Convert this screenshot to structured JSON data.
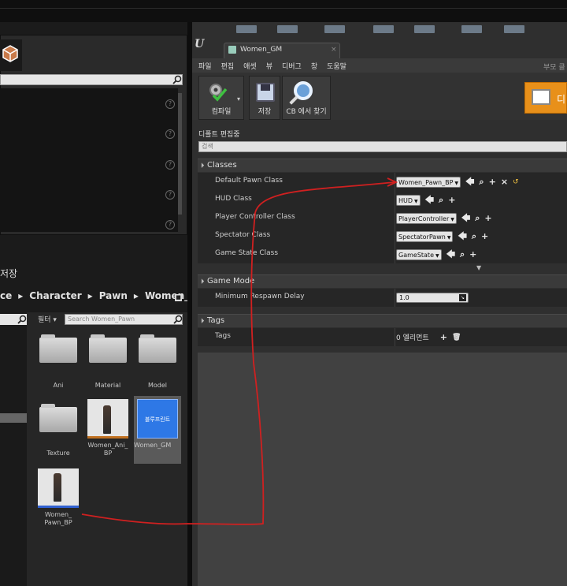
{
  "left_panel": {
    "save_label": "저장",
    "breadcrumbs": [
      "ce",
      "Character",
      "Pawn",
      "Women_P"
    ],
    "filter_label": "필터",
    "asset_search_placeholder": "Search Women_Pawn",
    "help_marks": [
      "?",
      "?",
      "?",
      "?",
      "?"
    ],
    "assets": [
      {
        "name": "Ani",
        "type": "folder"
      },
      {
        "name": "Material",
        "type": "folder"
      },
      {
        "name": "Model",
        "type": "folder"
      },
      {
        "name": "Texture",
        "type": "folder"
      },
      {
        "name": "Women_Ani_\nBP",
        "type": "anim-blueprint"
      },
      {
        "name": "Women_GM",
        "type": "blueprint",
        "thumb_text": "블루프린트",
        "selected": true
      },
      {
        "name": "Women_\nPawn_BP",
        "type": "pawn-blueprint"
      }
    ]
  },
  "editor": {
    "tab_title": "Women_GM",
    "tab_close": "×",
    "menu": [
      "파일",
      "편집",
      "애셋",
      "뷰",
      "디버그",
      "창",
      "도움말"
    ],
    "menu_right": "부모 클",
    "toolbar": {
      "compile_label": "컴파일",
      "save_label": "저장",
      "cb_label": "CB 에서 찾기",
      "default_label": "디"
    },
    "defaults_title": "디폴트 편집중",
    "search_placeholder": "검색",
    "categories": {
      "classes": "Classes",
      "game_mode": "Game Mode",
      "tags": "Tags"
    },
    "class_rows": [
      {
        "label": "Default Pawn Class",
        "value": "Women_Pawn_BP"
      },
      {
        "label": "HUD Class",
        "value": "HUD"
      },
      {
        "label": "Player Controller Class",
        "value": "PlayerController"
      },
      {
        "label": "Spectator Class",
        "value": "SpectatorPawn"
      },
      {
        "label": "Game State Class",
        "value": "GameState"
      }
    ],
    "game_mode_rows": [
      {
        "label": "Minimum Respawn Delay",
        "value": "1.0"
      }
    ],
    "tag_rows": [
      {
        "label": "Tags",
        "value": "0 엘리먼트"
      }
    ]
  },
  "annotation_color": "#d02020"
}
